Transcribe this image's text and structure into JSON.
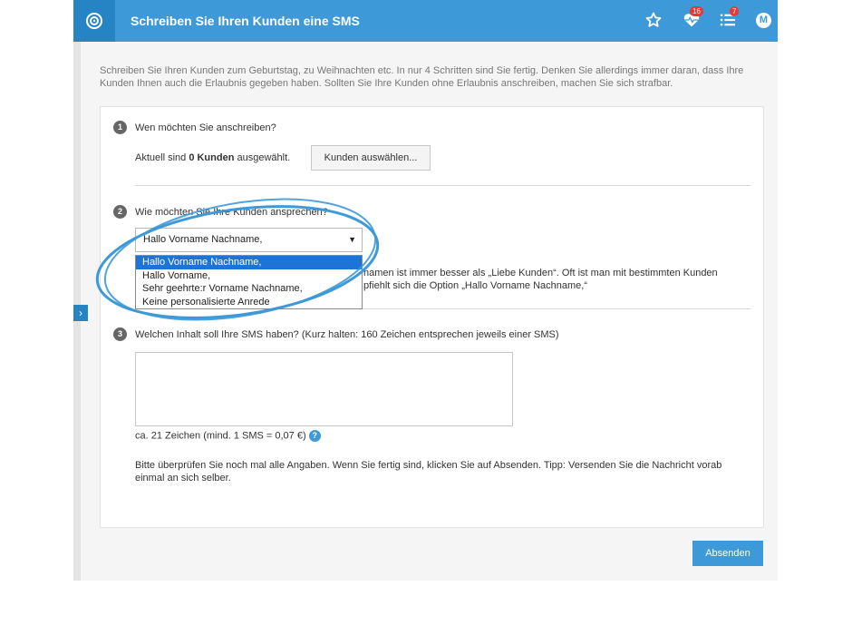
{
  "header": {
    "title": "Schreiben Sie Ihren Kunden eine SMS",
    "activity_badge": "16",
    "list_badge": "7",
    "avatar_initial": "M",
    "icons": [
      "target-icon",
      "star-icon",
      "heartbeat-icon",
      "list-icon"
    ]
  },
  "intro": "Schreiben Sie Ihren Kunden zum Geburtstag, zu Weihnachten etc. In nur 4 Schritten sind Sie fertig. Denken Sie allerdings immer daran, dass Ihre Kunden Ihnen auch die Erlaubnis gegeben haben. Sollten Sie Ihre Kunden ohne Erlaubnis anschreiben, machen Sie sich strafbar.",
  "step1": {
    "number": "1",
    "question": "Wen möchten Sie anschreiben?",
    "status_prefix": "Aktuell sind ",
    "status_count": "0 Kunden",
    "status_suffix": " ausgewählt.",
    "button": "Kunden auswählen..."
  },
  "step2": {
    "number": "2",
    "question": "Wie möchten Sie Ihre Kunden ansprechen?",
    "selected": "Hallo Vorname Nachname,",
    "options": [
      "Hallo Vorname Nachname,",
      "Hallo Vorname,",
      "Sehr geehrte:r Vorname Nachname,",
      "Keine personalisierte Anrede"
    ],
    "help_line1": "namen ist immer besser als „Liebe Kunden“. Oft ist man mit bestimmten Kunden",
    "help_line2": "pfiehlt sich die Option „Hallo Vorname Nachname,“"
  },
  "step3": {
    "number": "3",
    "question": "Welchen Inhalt soll Ihre SMS haben? (Kurz halten: 160 Zeichen entsprechen jeweils einer SMS)",
    "message": "",
    "counter": "ca. 21 Zeichen (mind. 1 SMS = 0,07 €)"
  },
  "final_text": "Bitte überprüfen Sie noch mal alle Angaben. Wenn Sie fertig sind, klicken Sie auf Absenden. Tipp: Versenden Sie die Nachricht vorab einmal an sich selber.",
  "submit_label": "Absenden",
  "colors": {
    "primary": "#3d99d8",
    "primary_dark": "#2784c4",
    "badge": "#e53935",
    "highlight_circle": "#3d99d8"
  }
}
